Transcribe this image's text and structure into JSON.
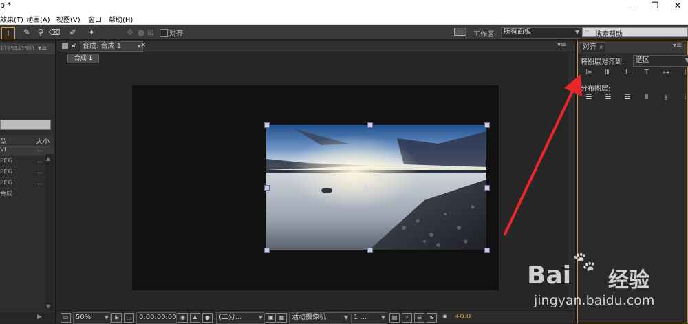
{
  "window": {
    "title": "p *",
    "controls": [
      "—",
      "❐",
      "✕"
    ]
  },
  "menu": [
    "效果(T)",
    "动画(A)",
    "视图(V)",
    "窗口",
    "帮助(H)"
  ],
  "toolbar": {
    "align_checkbox_label": "对齐",
    "workspace_label": "工作区:",
    "workspace_value": "所有面板",
    "search_placeholder": "搜索帮助"
  },
  "project": {
    "item_name": "1195441591",
    "col_type": "型",
    "col_size": "大小",
    "rows": [
      {
        "type": "VI",
        "size": "..."
      },
      {
        "type": "PEG",
        "size": "..."
      },
      {
        "type": "PEG",
        "size": "..."
      },
      {
        "type": "PEG",
        "size": "..."
      },
      {
        "type": "合成",
        "size": ""
      }
    ]
  },
  "composition": {
    "tab_label": "合成: 合成 1",
    "breadcrumb": "合成 1"
  },
  "align_panel": {
    "tab": "对齐",
    "align_to_label": "将图层对齐到:",
    "align_to_value": "选区",
    "distribute_label": "分布图层:"
  },
  "viewer_bar": {
    "zoom": "50%",
    "timecode": "0:00:00:00",
    "resolution": "(二分...",
    "camera": "活动摄像机",
    "views": "1 ...",
    "exposure": "+0.0"
  },
  "watermark": {
    "brand": "Bai",
    "brand_cn": "经验",
    "url": "jingyan.baidu.com"
  },
  "colors": {
    "accent": "#d8a032",
    "arrow": "#e8262a",
    "panel": "#2d2d2d"
  }
}
